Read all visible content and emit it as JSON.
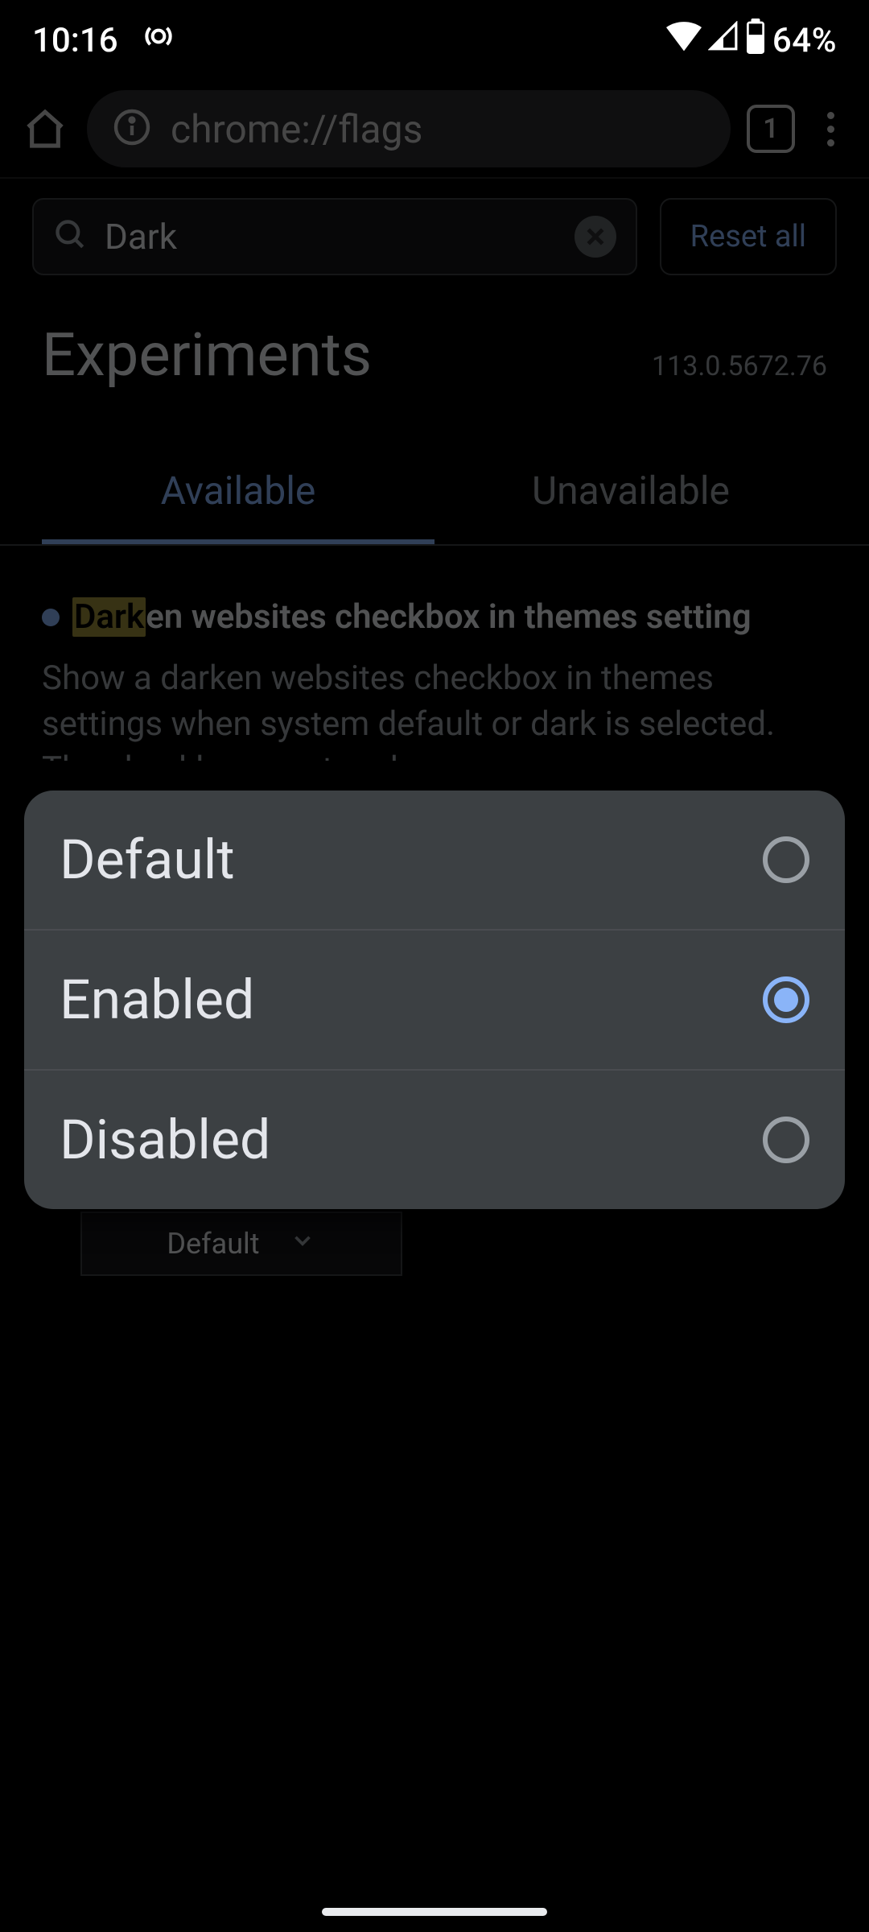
{
  "status": {
    "time": "10:16",
    "battery_text": "64%"
  },
  "browser": {
    "url": "chrome://flags",
    "tab_count": "1"
  },
  "searchbar": {
    "value": "Dark",
    "reset_label": "Reset all"
  },
  "header": {
    "title": "Experiments",
    "version": "113.0.5672.76"
  },
  "tabs": {
    "available": "Available",
    "unavailable": "Unavailable"
  },
  "flag": {
    "title_hl": "Dark",
    "title_rest": "en websites checkbox in themes setting",
    "description": "Show a darken websites checkbox in themes settings when system default or dark is selected. The checkbox can toggle",
    "dropdown_value": "Default"
  },
  "dialog": {
    "options": [
      "Default",
      "Enabled",
      "Disabled"
    ],
    "selected_index": 1
  }
}
